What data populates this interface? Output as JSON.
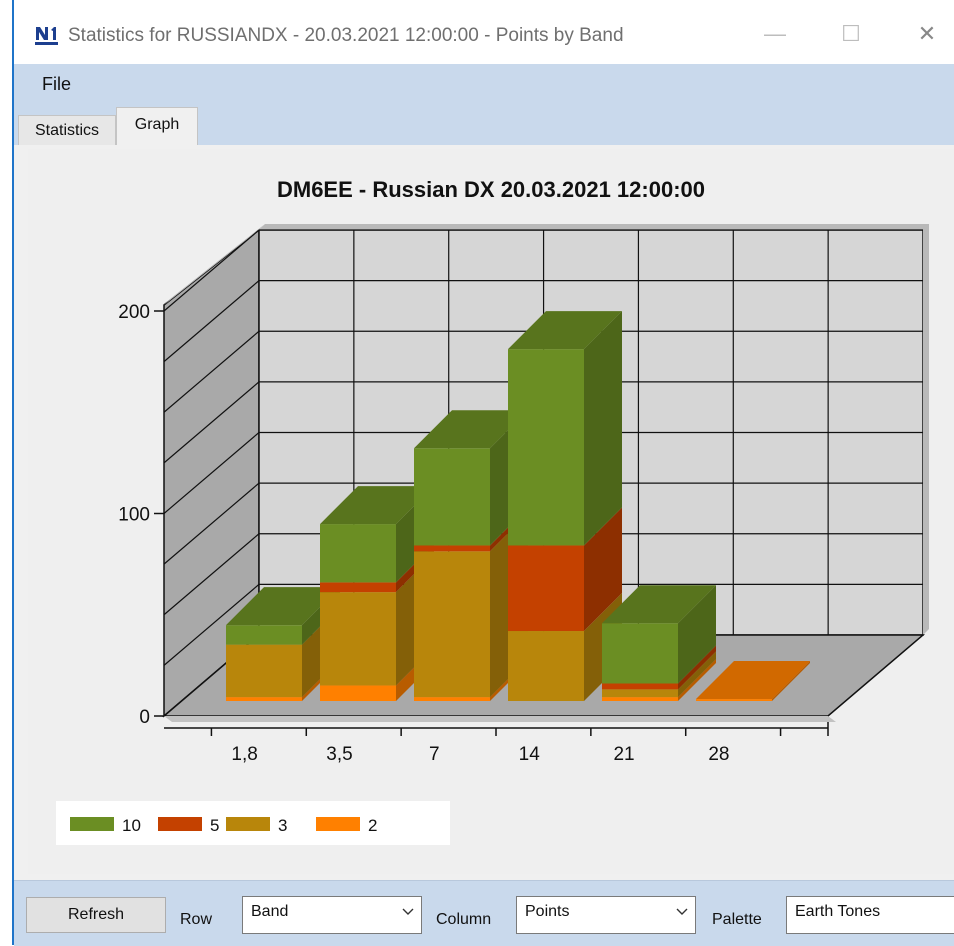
{
  "window": {
    "title": "Statistics for RUSSIANDX - 20.03.2021 12:00:00 - Points by Band",
    "icon": "n1mm-app-icon",
    "controls": {
      "minimize": "—",
      "maximize": "☐",
      "close": "✕"
    }
  },
  "menu": {
    "file_label": "File"
  },
  "tabs": [
    {
      "label": "Statistics",
      "active": false
    },
    {
      "label": "Graph",
      "active": true
    }
  ],
  "bottom": {
    "refresh_label": "Refresh",
    "row_label": "Row",
    "row_value": "Band",
    "column_label": "Column",
    "column_value": "Points",
    "palette_label": "Palette",
    "palette_value": "Earth Tones"
  },
  "colors": {
    "10": "#6b8e23",
    "5": "#c44100",
    "3": "#b8860b",
    "2": "#ff8000"
  },
  "chart_data": {
    "type": "bar",
    "stacked": true,
    "three_d": true,
    "title": "DM6EE - Russian DX 20.03.2021 12:00:00",
    "categories": [
      "1,8",
      "3,5",
      "7",
      "14",
      "21",
      "28"
    ],
    "ylim": [
      0,
      200
    ],
    "yticks": [
      0,
      100,
      200
    ],
    "grid": true,
    "legend_position": "bottom-left",
    "series": [
      {
        "name": "2",
        "color": "#ff8000",
        "values": [
          2,
          8,
          2,
          0,
          2,
          1
        ]
      },
      {
        "name": "3",
        "color": "#b8860b",
        "values": [
          27,
          48,
          75,
          36,
          4,
          0
        ]
      },
      {
        "name": "5",
        "color": "#c44100",
        "values": [
          0,
          5,
          3,
          44,
          3,
          0
        ]
      },
      {
        "name": "10",
        "color": "#6b8e23",
        "values": [
          10,
          30,
          50,
          101,
          31,
          0
        ]
      }
    ],
    "legend_order": [
      "10",
      "5",
      "3",
      "2"
    ]
  }
}
